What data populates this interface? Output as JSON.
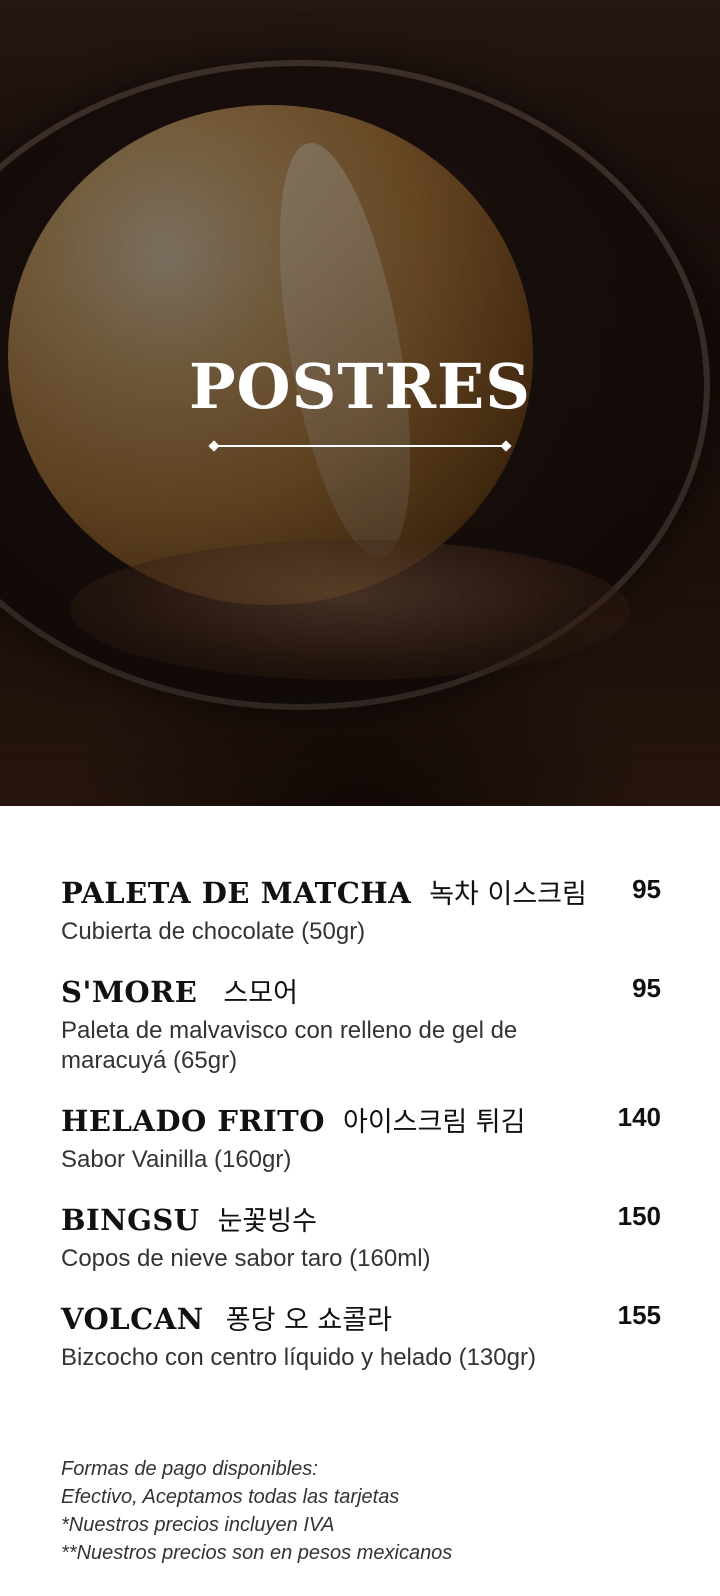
{
  "hero": {
    "title": "POSTRES"
  },
  "menu": {
    "items": [
      {
        "name": "PALETA DE MATCHA",
        "korean": "녹차 이스크림",
        "price": "95",
        "description": "Cubierta de chocolate (50gr)"
      },
      {
        "name": "S'MORE",
        "korean": "스모어",
        "price": "95",
        "description": "Paleta de malvavisco con relleno de gel de maracuyá (65gr)"
      },
      {
        "name": "HELADO FRITO",
        "korean": "아이스크림 튀김",
        "price": "140",
        "description": "Sabor Vainilla (160gr)"
      },
      {
        "name": "BINGSU",
        "korean": "눈꽃빙수",
        "price": "150",
        "description": "Copos de nieve sabor taro (160ml)"
      },
      {
        "name": "VOLCAN",
        "korean": "퐁당 오 쇼콜라",
        "price": "155",
        "description": "Bizcocho con centro líquido y helado (130gr)"
      }
    ]
  },
  "footer": {
    "lines": [
      "Formas de pago disponibles:",
      "Efectivo, Aceptamos todas las tarjetas",
      "*Nuestros precios incluyen IVA",
      "**Nuestros precios son en pesos mexicanos"
    ]
  }
}
